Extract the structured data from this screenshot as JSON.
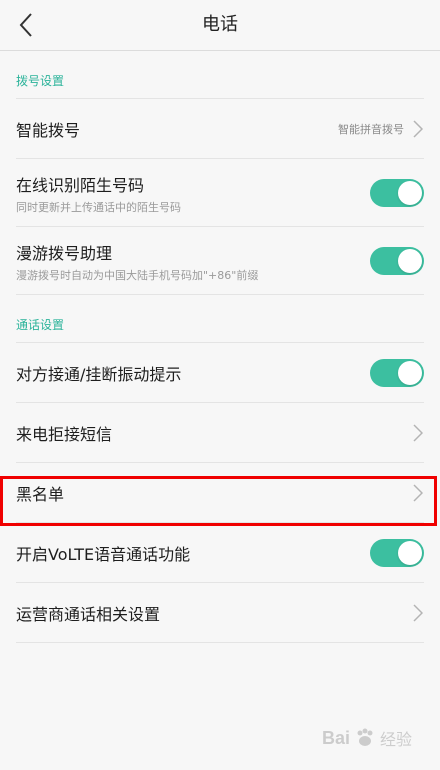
{
  "header": {
    "title": "电话"
  },
  "sections": [
    {
      "label": "拨号设置",
      "rows": [
        {
          "title": "智能拨号",
          "value": "智能拼音拨号",
          "type": "chevron"
        },
        {
          "title": "在线识别陌生号码",
          "subtitle": "同时更新并上传通话中的陌生号码",
          "type": "toggle",
          "state": "on"
        },
        {
          "title": "漫游拨号助理",
          "subtitle": "漫游拨号时自动为中国大陆手机号码加\"+86\"前缀",
          "type": "toggle",
          "state": "on"
        }
      ]
    },
    {
      "label": "通话设置",
      "rows": [
        {
          "title": "对方接通/挂断振动提示",
          "type": "toggle",
          "state": "on"
        },
        {
          "title": "来电拒接短信",
          "type": "chevron"
        },
        {
          "title": "黑名单",
          "type": "chevron",
          "highlighted": true
        },
        {
          "title": "开启VoLTE语音通话功能",
          "type": "toggle",
          "state": "on"
        },
        {
          "title": "运营商通话相关设置",
          "type": "chevron"
        }
      ]
    }
  ],
  "watermark": {
    "brand": "Bai",
    "sub": "经验"
  },
  "colors": {
    "accent": "#2bb39a",
    "toggle_on": "#3cbfa0",
    "highlight": "#f00000"
  }
}
